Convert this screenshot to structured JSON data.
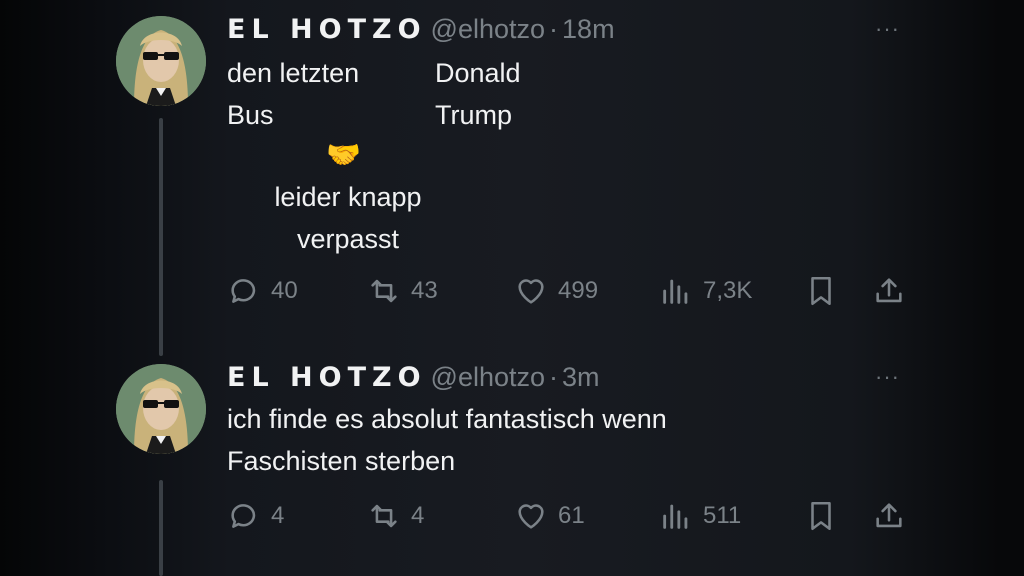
{
  "tweets": [
    {
      "author": {
        "name": "EL HOTZO",
        "handle": "@elhotzo",
        "separator": "·",
        "time": "18m"
      },
      "more": "···",
      "text": {
        "col1_line1": "den letzten",
        "col1_line2": "Bus",
        "col2_line1": "Donald",
        "col2_line2": "Trump",
        "emoji": "🤝",
        "caption_line1": "leider knapp",
        "caption_line2": "verpasst"
      },
      "stats": {
        "replies": "40",
        "reposts": "43",
        "likes": "499",
        "views": "7,3K"
      }
    },
    {
      "author": {
        "name": "EL HOTZO",
        "handle": "@elhotzo",
        "separator": "·",
        "time": "3m"
      },
      "more": "···",
      "text": {
        "line1": "ich finde es absolut fantastisch wenn",
        "line2": "Faschisten sterben"
      },
      "stats": {
        "replies": "4",
        "reposts": "4",
        "likes": "61",
        "views": "511"
      }
    }
  ],
  "icons": {
    "reply": "speech-bubble-icon",
    "repost": "repost-arrows-icon",
    "like": "heart-icon",
    "views": "bar-chart-icon",
    "bookmark": "bookmark-icon",
    "share": "share-upload-icon",
    "more": "ellipsis-icon"
  },
  "colors": {
    "background": "#16191e",
    "text_primary": "#f1f2f3",
    "text_secondary": "#7b8288",
    "thread_line": "#3a3f45",
    "emoji": "#f3b72c"
  }
}
